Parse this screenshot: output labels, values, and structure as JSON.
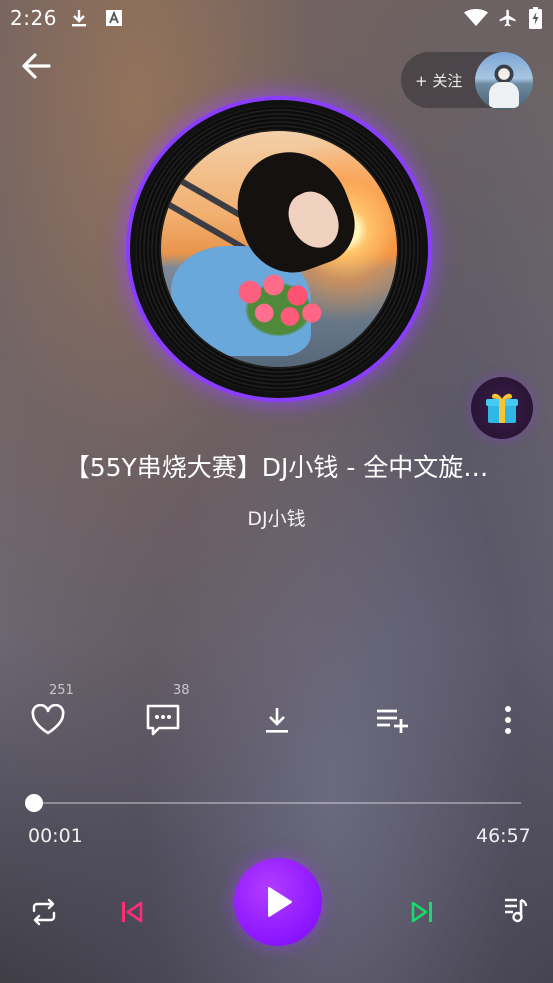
{
  "status_bar": {
    "time": "2:26"
  },
  "header": {
    "follow_label": "+ 关注"
  },
  "song": {
    "title": "【55Y串烧大赛】DJ小钱 - 全中文旋…",
    "artist": "DJ小钱"
  },
  "actions": {
    "like_count": "251",
    "comment_count": "38"
  },
  "progress": {
    "current": "00:01",
    "total": "46:57",
    "fraction": 0.0004
  },
  "colors": {
    "accent": "#8a15ff",
    "prev": "#ff2d78",
    "next": "#17d96e",
    "glow": "#8b3dff"
  },
  "icons": [
    "download-status-icon",
    "font-status-icon",
    "wifi-icon",
    "airplane-icon",
    "battery-icon",
    "back-arrow-icon",
    "gift-icon",
    "heart-icon",
    "comment-icon",
    "download-icon",
    "add-to-playlist-icon",
    "more-icon",
    "repeat-icon",
    "previous-icon",
    "play-icon",
    "next-icon",
    "playlist-icon"
  ]
}
